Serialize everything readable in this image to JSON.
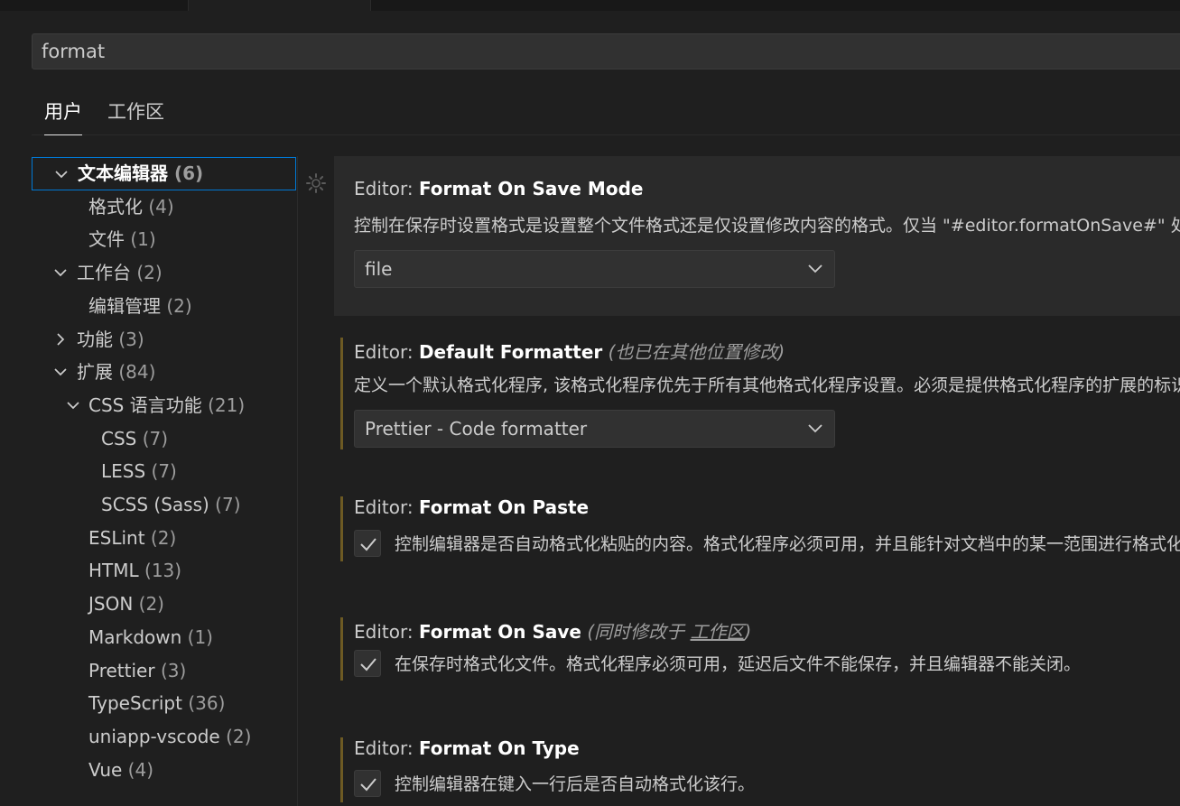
{
  "search": {
    "value": "format"
  },
  "scope_tabs": [
    {
      "label": "用户"
    },
    {
      "label": "工作区"
    }
  ],
  "toc": [
    {
      "label": "文本编辑器",
      "count": "(6)",
      "chevron": "down",
      "indent": 0
    },
    {
      "label": "格式化",
      "count": "(4)",
      "chevron": "",
      "indent": 1
    },
    {
      "label": "文件",
      "count": "(1)",
      "chevron": "",
      "indent": 1
    },
    {
      "label": "工作台",
      "count": "(2)",
      "chevron": "down",
      "indent": 0
    },
    {
      "label": "编辑管理",
      "count": "(2)",
      "chevron": "",
      "indent": 1
    },
    {
      "label": "功能",
      "count": "(3)",
      "chevron": "right",
      "indent": 0
    },
    {
      "label": "扩展",
      "count": "(84)",
      "chevron": "down",
      "indent": 0
    },
    {
      "label": "CSS 语言功能",
      "count": "(21)",
      "chevron": "down",
      "indent": 1
    },
    {
      "label": "CSS",
      "count": "(7)",
      "chevron": "",
      "indent": 2
    },
    {
      "label": "LESS",
      "count": "(7)",
      "chevron": "",
      "indent": 2
    },
    {
      "label": "SCSS (Sass)",
      "count": "(7)",
      "chevron": "",
      "indent": 2
    },
    {
      "label": "ESLint",
      "count": "(2)",
      "chevron": "",
      "indent": 1
    },
    {
      "label": "HTML",
      "count": "(13)",
      "chevron": "",
      "indent": 1
    },
    {
      "label": "JSON",
      "count": "(2)",
      "chevron": "",
      "indent": 1
    },
    {
      "label": "Markdown",
      "count": "(1)",
      "chevron": "",
      "indent": 1
    },
    {
      "label": "Prettier",
      "count": "(3)",
      "chevron": "",
      "indent": 1
    },
    {
      "label": "TypeScript",
      "count": "(36)",
      "chevron": "",
      "indent": 1
    },
    {
      "label": "uniapp-vscode",
      "count": "(2)",
      "chevron": "",
      "indent": 1
    },
    {
      "label": "Vue",
      "count": "(4)",
      "chevron": "",
      "indent": 1
    }
  ],
  "settings": {
    "format_on_save_mode": {
      "category": "Editor: ",
      "name": "Format On Save Mode",
      "description": "控制在保存时设置格式是设置整个文件格式还是仅设置修改内容的格式。仅当 \"#editor.formatOnSave#\" 处于启用状态时适用。",
      "value": "file"
    },
    "default_formatter": {
      "category": "Editor: ",
      "name": "Default Formatter",
      "note": "(也已在其他位置修改)",
      "description": "定义一个默认格式化程序, 该格式化程序优先于所有其他格式化程序设置。必须是提供格式化程序的扩展的标识符。",
      "value": "Prettier - Code formatter"
    },
    "format_on_paste": {
      "category": "Editor: ",
      "name": "Format On Paste",
      "description": "控制编辑器是否自动格式化粘贴的内容。格式化程序必须可用，并且能针对文档中的某一范围进行格式化。",
      "checked": true
    },
    "format_on_save": {
      "category": "Editor: ",
      "name": "Format On Save",
      "note_prefix": "(同时修改于 ",
      "note_link": "工作区",
      "note_suffix": ")",
      "description": "在保存时格式化文件。格式化程序必须可用，延迟后文件不能保存，并且编辑器不能关闭。",
      "checked": true
    },
    "format_on_type": {
      "category": "Editor: ",
      "name": "Format On Type",
      "description": "控制编辑器在键入一行后是否自动格式化该行。",
      "checked": true
    }
  },
  "colors": {
    "accent": "#0078d4",
    "modified_bar": "#6d5a23"
  }
}
